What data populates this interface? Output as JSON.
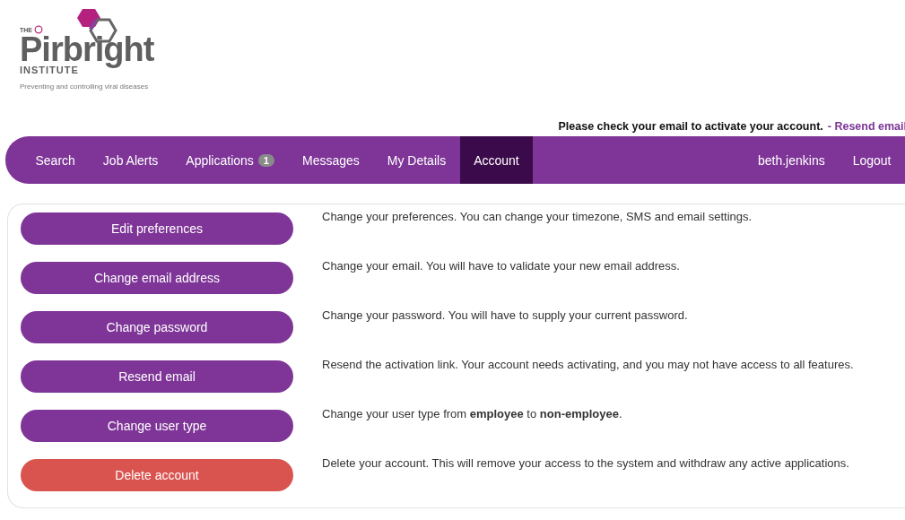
{
  "logo": {
    "prefix": "THE",
    "name": "Pirbright",
    "suffix": "INSTITUTE",
    "tagline": "Preventing and controlling viral diseases"
  },
  "notice": {
    "text": "Please check your email to activate your account.",
    "link": "- Resend email"
  },
  "nav": {
    "items": [
      {
        "label": "Search",
        "selected": false
      },
      {
        "label": "Job Alerts",
        "selected": false
      },
      {
        "label": "Applications",
        "badge": "1",
        "selected": false
      },
      {
        "label": "Messages",
        "selected": false
      },
      {
        "label": "My Details",
        "selected": false
      },
      {
        "label": "Account",
        "selected": true
      }
    ],
    "right": [
      {
        "label": "beth.jenkins"
      },
      {
        "label": "Logout"
      }
    ]
  },
  "actions": [
    {
      "button": "Edit preferences",
      "kind": "primary",
      "description": "Change your preferences. You can change your timezone, SMS and email settings."
    },
    {
      "button": "Change email address",
      "kind": "primary",
      "description": "Change your email. You will have to validate your new email address."
    },
    {
      "button": "Change password",
      "kind": "primary",
      "description": "Change your password. You will have to supply your current password."
    },
    {
      "button": "Resend email",
      "kind": "primary",
      "description": "Resend the activation link. Your account needs activating, and you may not have access to all features."
    },
    {
      "button": "Change user type",
      "kind": "primary",
      "description": "Change your user type from **employee** to **non-employee**."
    },
    {
      "button": "Delete account",
      "kind": "danger",
      "description": "Delete your account. This will remove your access to the system and withdraw any active applications."
    }
  ]
}
